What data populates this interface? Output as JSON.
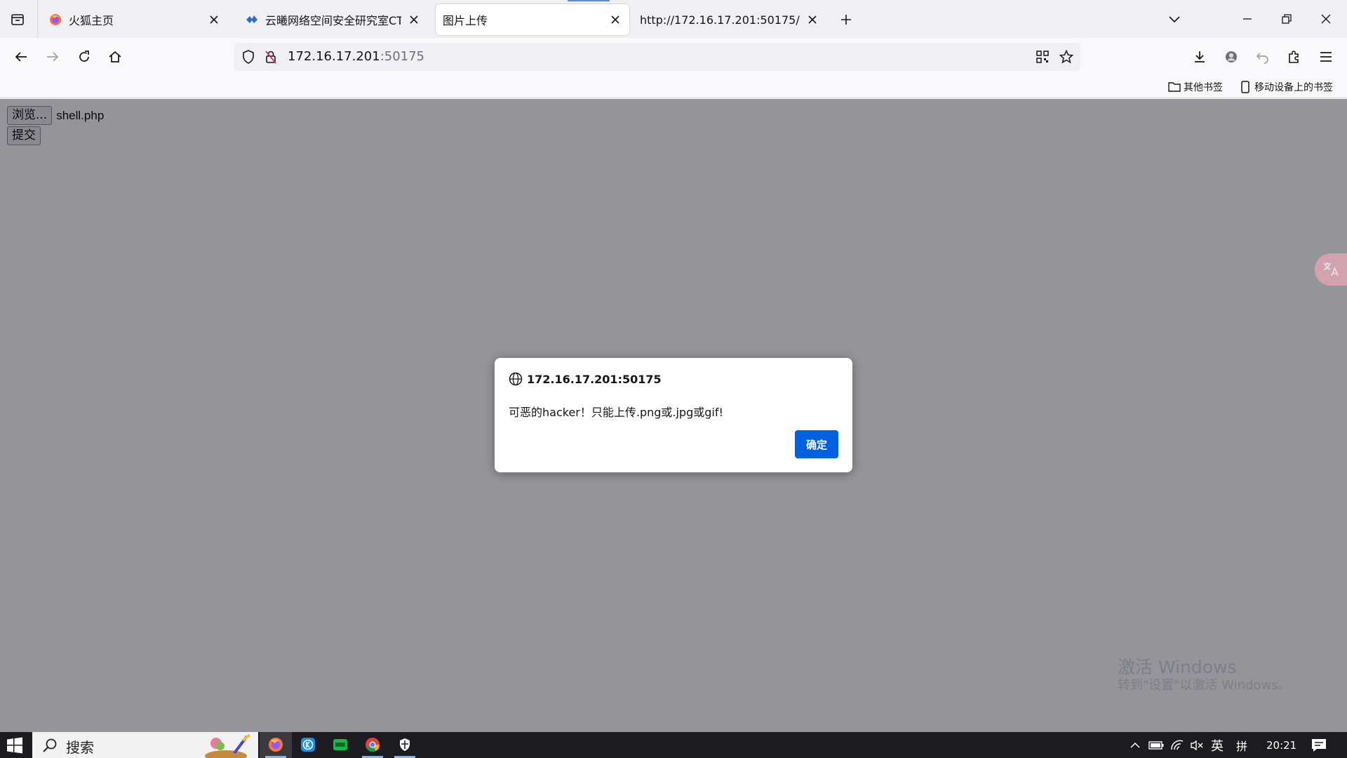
{
  "tabs": [
    {
      "title": "火狐主页",
      "favicon": "firefox-icon",
      "active": false
    },
    {
      "title": "云曦网络空间安全研究室CTF靶",
      "favicon": "lab-logo-icon",
      "active": false
    },
    {
      "title": "图片上传",
      "favicon": "",
      "active": true
    },
    {
      "title": "http://172.16.17.201:50175/",
      "favicon": "",
      "active": false
    }
  ],
  "urlbar": {
    "host": "172.16.17.201",
    "port": ":50175"
  },
  "bookmarks": {
    "other": "其他书签",
    "mobile": "移动设备上的书签"
  },
  "page": {
    "browse_label": "浏览...",
    "file_name": "shell.php",
    "submit_label": "提交"
  },
  "dialog": {
    "origin": "172.16.17.201:50175",
    "message": "可恶的hacker！只能上传.png或.jpg或gif!",
    "ok_label": "确定"
  },
  "watermark": {
    "line1": "激活 Windows",
    "line2": "转到\"设置\"以激活 Windows。"
  },
  "taskbar": {
    "search_label": "搜索",
    "ime_lang": "英",
    "ime_mode": "拼",
    "clock": "20:21"
  },
  "colors": {
    "accent": "#0061e0",
    "taskbar": "#1c1c20"
  }
}
